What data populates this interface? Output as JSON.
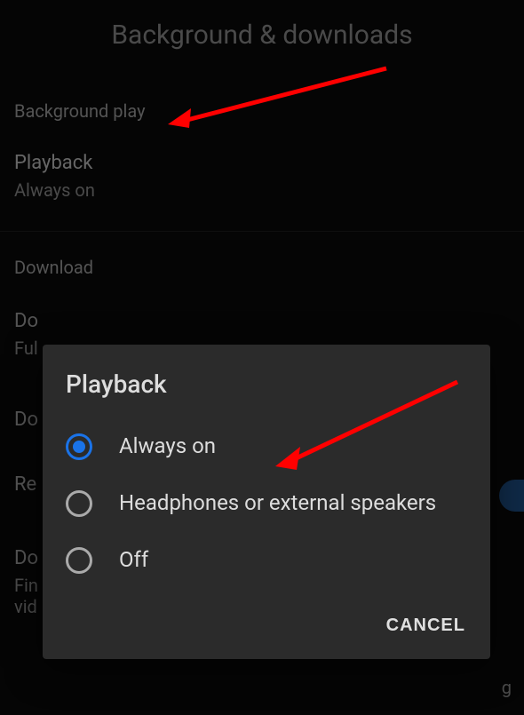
{
  "header": {
    "title": "Background & downloads"
  },
  "sections": {
    "bg_play_header": "Background play",
    "playback": {
      "label": "Playback",
      "value": "Always on"
    },
    "download_header": "Download",
    "download_network": {
      "label": "Do",
      "value": "Ful"
    },
    "item2": {
      "label": "Do"
    },
    "item3": {
      "label": "Re"
    },
    "item4": {
      "label": "Do",
      "value1": "Fin",
      "value2": "vid"
    },
    "trailing_g": "g"
  },
  "dialog": {
    "title": "Playback",
    "options": [
      {
        "label": "Always on",
        "selected": true
      },
      {
        "label": "Headphones or external speakers",
        "selected": false
      },
      {
        "label": "Off",
        "selected": false
      }
    ],
    "cancel": "CANCEL"
  }
}
